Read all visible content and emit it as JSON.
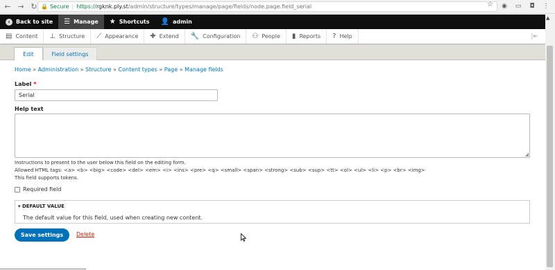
{
  "browser": {
    "secure_label": "Secure",
    "url_scheme": "https://",
    "url_host": "rgknk.ply.st",
    "url_path": "/admin/structure/types/manage/page/fields/node.page.field_serial"
  },
  "toolbar": {
    "back_to_site": "Back to site",
    "manage": "Manage",
    "shortcuts": "Shortcuts",
    "admin": "admin"
  },
  "tray": {
    "items": [
      "Content",
      "Structure",
      "Appearance",
      "Extend",
      "Configuration",
      "People",
      "Reports",
      "Help"
    ]
  },
  "tabs": {
    "edit": "Edit",
    "field_settings": "Field settings"
  },
  "breadcrumb": {
    "items": [
      "Home",
      "Administration",
      "Structure",
      "Content types",
      "Page",
      "Manage fields"
    ],
    "separator": "»"
  },
  "form": {
    "label_label": "Label",
    "required_mark": "*",
    "label_value": "Serial",
    "help_label": "Help text",
    "help_desc_1": "Instructions to present to the user below this field on the editing form.",
    "help_desc_2": "Allowed HTML tags: <a> <b> <big> <code> <del> <em> <i> <ins> <pre> <q> <small> <span> <strong> <sub> <sup> <tt> <ol> <ul> <li> <p> <br> <img>",
    "help_desc_3": "This field supports tokens.",
    "required_field": "Required field",
    "default_value_summary": "▾ DEFAULT VALUE",
    "default_value_desc": "The default value for this field, used when creating new content.",
    "save_button": "Save settings",
    "delete_link": "Delete"
  },
  "colors": {
    "link": "#0074bd",
    "primary_button": "#0071b8",
    "delete": "#c72100",
    "toolbar_bg": "#0f0f0f",
    "tabs_bg": "#e1e0d8"
  }
}
